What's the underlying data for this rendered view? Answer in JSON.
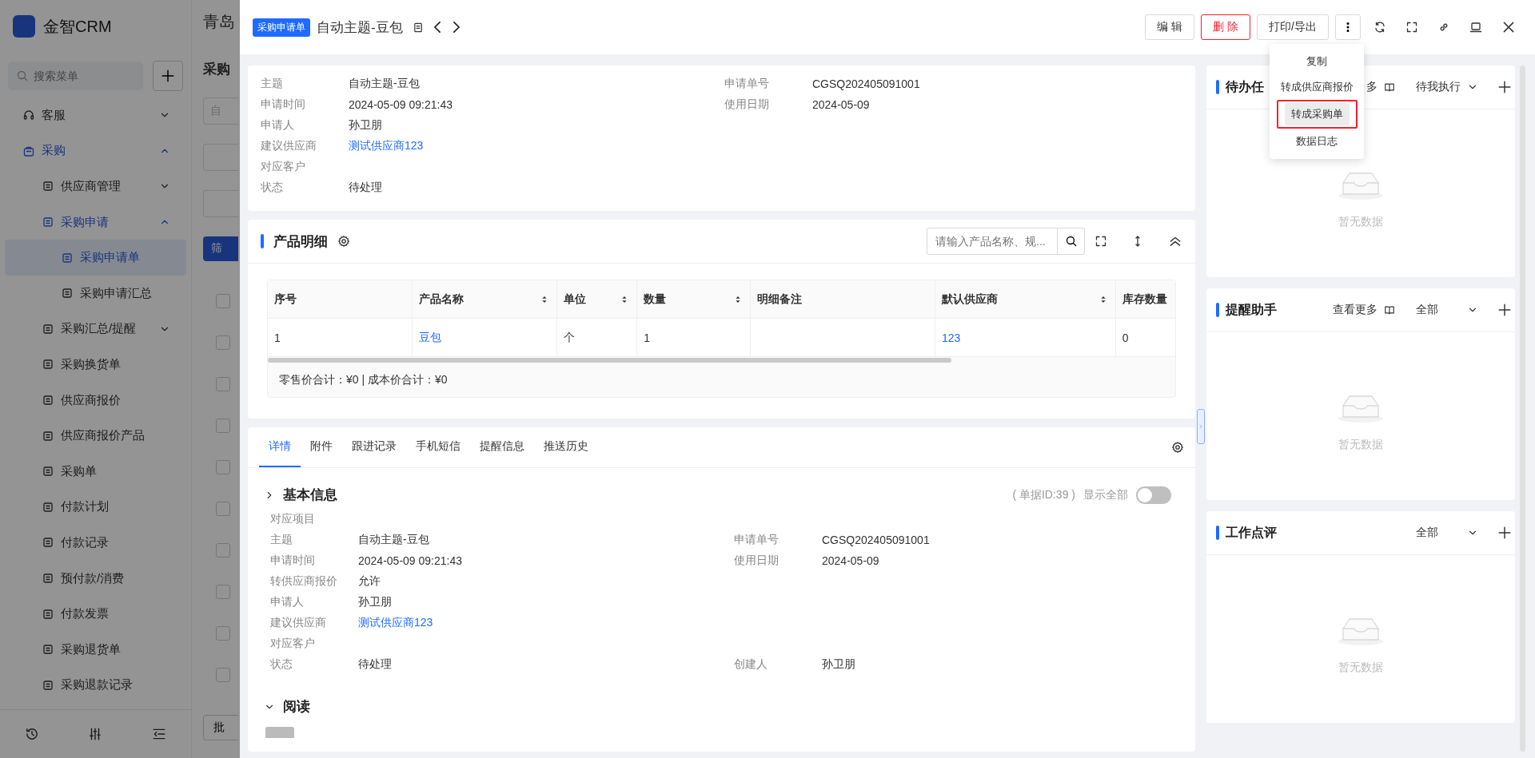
{
  "background": {
    "app_name": "金智CRM",
    "search": {
      "placeholder": "搜索菜单"
    },
    "header_title": "青岛",
    "page_title": "采购",
    "filter_placeholder": "自",
    "filter_button": "筛",
    "batch_button": "批",
    "row_checkboxes": [
      {
        "checked": false
      },
      {
        "checked": false
      },
      {
        "checked": false
      },
      {
        "checked": false
      },
      {
        "checked": false
      },
      {
        "checked": false
      },
      {
        "checked": false
      },
      {
        "checked": false
      },
      {
        "checked": false
      },
      {
        "checked": false
      }
    ],
    "menu": [
      {
        "label": "客服",
        "expanded": false
      },
      {
        "label": "采购",
        "expanded": true,
        "children": [
          {
            "label": "供应商管理",
            "expanded": false
          },
          {
            "label": "采购申请",
            "expanded": true,
            "children": [
              {
                "label": "采购申请单",
                "selected": true
              },
              {
                "label": "采购申请汇总",
                "selected": false
              }
            ]
          },
          {
            "label": "采购汇总/提醒",
            "expanded": false
          },
          {
            "label": "采购换货单",
            "selected": false
          },
          {
            "label": "供应商报价",
            "selected": false
          },
          {
            "label": "供应商报价产品",
            "selected": false
          },
          {
            "label": "采购单",
            "selected": false
          },
          {
            "label": "付款计划",
            "selected": false
          },
          {
            "label": "付款记录",
            "selected": false
          },
          {
            "label": "预付款/消费",
            "selected": false
          },
          {
            "label": "付款发票",
            "selected": false
          },
          {
            "label": "采购退货单",
            "selected": false
          },
          {
            "label": "采购退款记录",
            "selected": false
          }
        ]
      }
    ]
  },
  "drawer": {
    "tag": "采购申请单",
    "title": "自动主题-豆包",
    "buttons": [
      {
        "label": "编 辑",
        "kind": "default"
      },
      {
        "label": "删 除",
        "kind": "danger"
      },
      {
        "label": "打印/导出",
        "kind": "default"
      }
    ],
    "menu": [
      {
        "label": "复制",
        "highlighted": false
      },
      {
        "label": "转成供应商报价",
        "highlighted": false
      },
      {
        "label": "转成采购单",
        "highlighted": true
      },
      {
        "label": "数据日志",
        "highlighted": false
      }
    ],
    "info": {
      "rows": [
        [
          {
            "label": "主题",
            "value": "自动主题-豆包",
            "kind": "text"
          },
          {
            "label": "申请单号",
            "value": "CGSQ202405091001",
            "kind": "text"
          }
        ],
        [
          {
            "label": "申请时间",
            "value": "2024-05-09 09:21:43",
            "kind": "text"
          },
          {
            "label": "使用日期",
            "value": "2024-05-09",
            "kind": "text"
          }
        ],
        [
          {
            "label": "申请人",
            "value": "孙卫朋",
            "kind": "text"
          }
        ],
        [
          {
            "label": "建议供应商",
            "value": "测试供应商123",
            "kind": "link"
          }
        ],
        [
          {
            "label": "对应客户"
          }
        ],
        [
          {
            "label": "状态",
            "value": "待处理",
            "kind": "text"
          }
        ]
      ]
    },
    "products": {
      "title": "产品明细",
      "search": {
        "placeholder": "请输入产品名称、规..."
      },
      "columns": [
        {
          "label": "序号",
          "sortable": false
        },
        {
          "label": "产品名称",
          "sortable": true
        },
        {
          "label": "单位",
          "sortable": true
        },
        {
          "label": "数量",
          "sortable": true
        },
        {
          "label": "明细备注",
          "sortable": false
        },
        {
          "label": "默认供应商",
          "sortable": true
        },
        {
          "label": "库存数量",
          "sortable": false
        }
      ],
      "rows": [
        [
          {
            "value": "1",
            "kind": "text"
          },
          {
            "value": "豆包",
            "kind": "link"
          },
          {
            "value": "个",
            "kind": "text"
          },
          {
            "value": "1",
            "kind": "text"
          },
          {},
          {
            "value": "123",
            "kind": "link"
          },
          {
            "value": "0",
            "kind": "text"
          }
        ]
      ],
      "footer": "零售价合计：¥0 |   成本价合计：¥0"
    },
    "tabs": [
      {
        "label": "详情",
        "selected": true
      },
      {
        "label": "附件",
        "selected": false
      },
      {
        "label": "跟进记录",
        "selected": false
      },
      {
        "label": "手机短信",
        "selected": false
      },
      {
        "label": "提醒信息",
        "selected": false
      },
      {
        "label": "推送历史",
        "selected": false
      }
    ],
    "basic_info": {
      "title": "基本信息",
      "id_text": "( 单据ID:39 )",
      "show_all": {
        "label": "显示全部",
        "on": false
      },
      "rows": [
        [
          {
            "label": "对应项目"
          }
        ],
        [
          {
            "label": "主题",
            "value": "自动主题-豆包",
            "kind": "text"
          },
          {
            "label": "申请单号",
            "value": "CGSQ202405091001",
            "kind": "text"
          }
        ],
        [
          {
            "label": "申请时间",
            "value": "2024-05-09 09:21:43",
            "kind": "text"
          },
          {
            "label": "使用日期",
            "value": "2024-05-09",
            "kind": "text"
          }
        ],
        [
          {
            "label": "转供应商报价",
            "value": "允许",
            "kind": "text"
          }
        ],
        [
          {
            "label": "申请人",
            "value": "孙卫朋",
            "kind": "text"
          }
        ],
        [
          {
            "label": "建议供应商",
            "value": "测试供应商123",
            "kind": "link"
          }
        ],
        [
          {
            "label": "对应客户"
          }
        ],
        [
          {
            "label": "状态",
            "value": "待处理",
            "kind": "text"
          },
          {
            "label": "创建人",
            "value": "孙卫朋",
            "kind": "text"
          }
        ]
      ]
    },
    "read_section": {
      "title": "阅读"
    },
    "panels": [
      {
        "title": "待办任",
        "more": "多",
        "filter": "待我执行",
        "empty": "暂无数据"
      },
      {
        "title": "提醒助手",
        "more": "查看更多",
        "filter": "全部",
        "empty": "暂无数据"
      },
      {
        "title": "工作点评",
        "filter": "全部",
        "empty": "暂无数据"
      }
    ]
  }
}
